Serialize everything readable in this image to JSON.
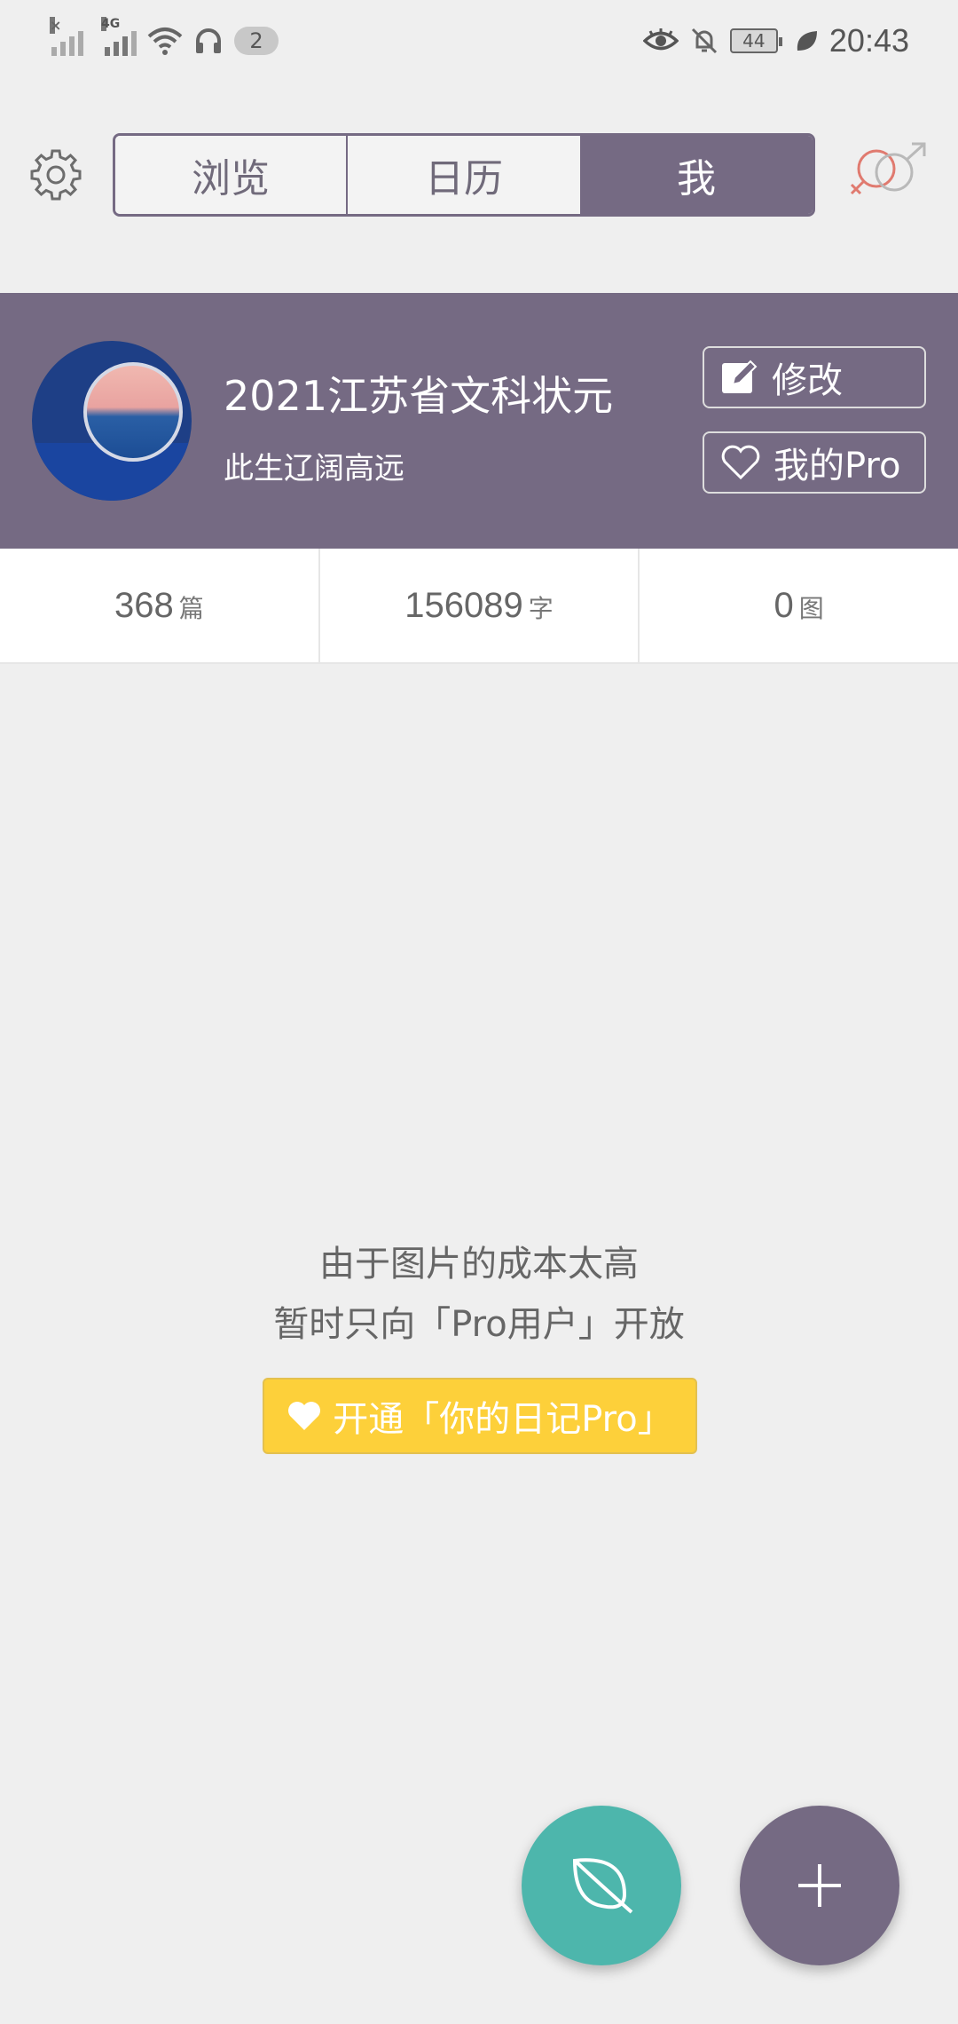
{
  "status_bar": {
    "net_type": "4G",
    "notif_count": "2",
    "battery": "44",
    "time": "20:43"
  },
  "header": {
    "tabs": [
      "浏览",
      "日历",
      "我"
    ],
    "active_tab": "我",
    "accent_color": "#756a83"
  },
  "profile": {
    "nickname": "2021江苏省文科状元",
    "motto": "此生辽阔高远",
    "edit_label": "修改",
    "pro_label": "我的Pro"
  },
  "stats": [
    {
      "value": "368",
      "unit": "篇"
    },
    {
      "value": "156089",
      "unit": "字"
    },
    {
      "value": "0",
      "unit": "图"
    }
  ],
  "notice": {
    "line1": "由于图片的成本太高",
    "line2": "暂时只向「Pro用户」开放",
    "cta_label": "开通「你的日记Pro」",
    "cta_color": "#fdd03a"
  },
  "fabs": {
    "leaf_color": "#4db6ac",
    "add_color": "#756a83"
  }
}
